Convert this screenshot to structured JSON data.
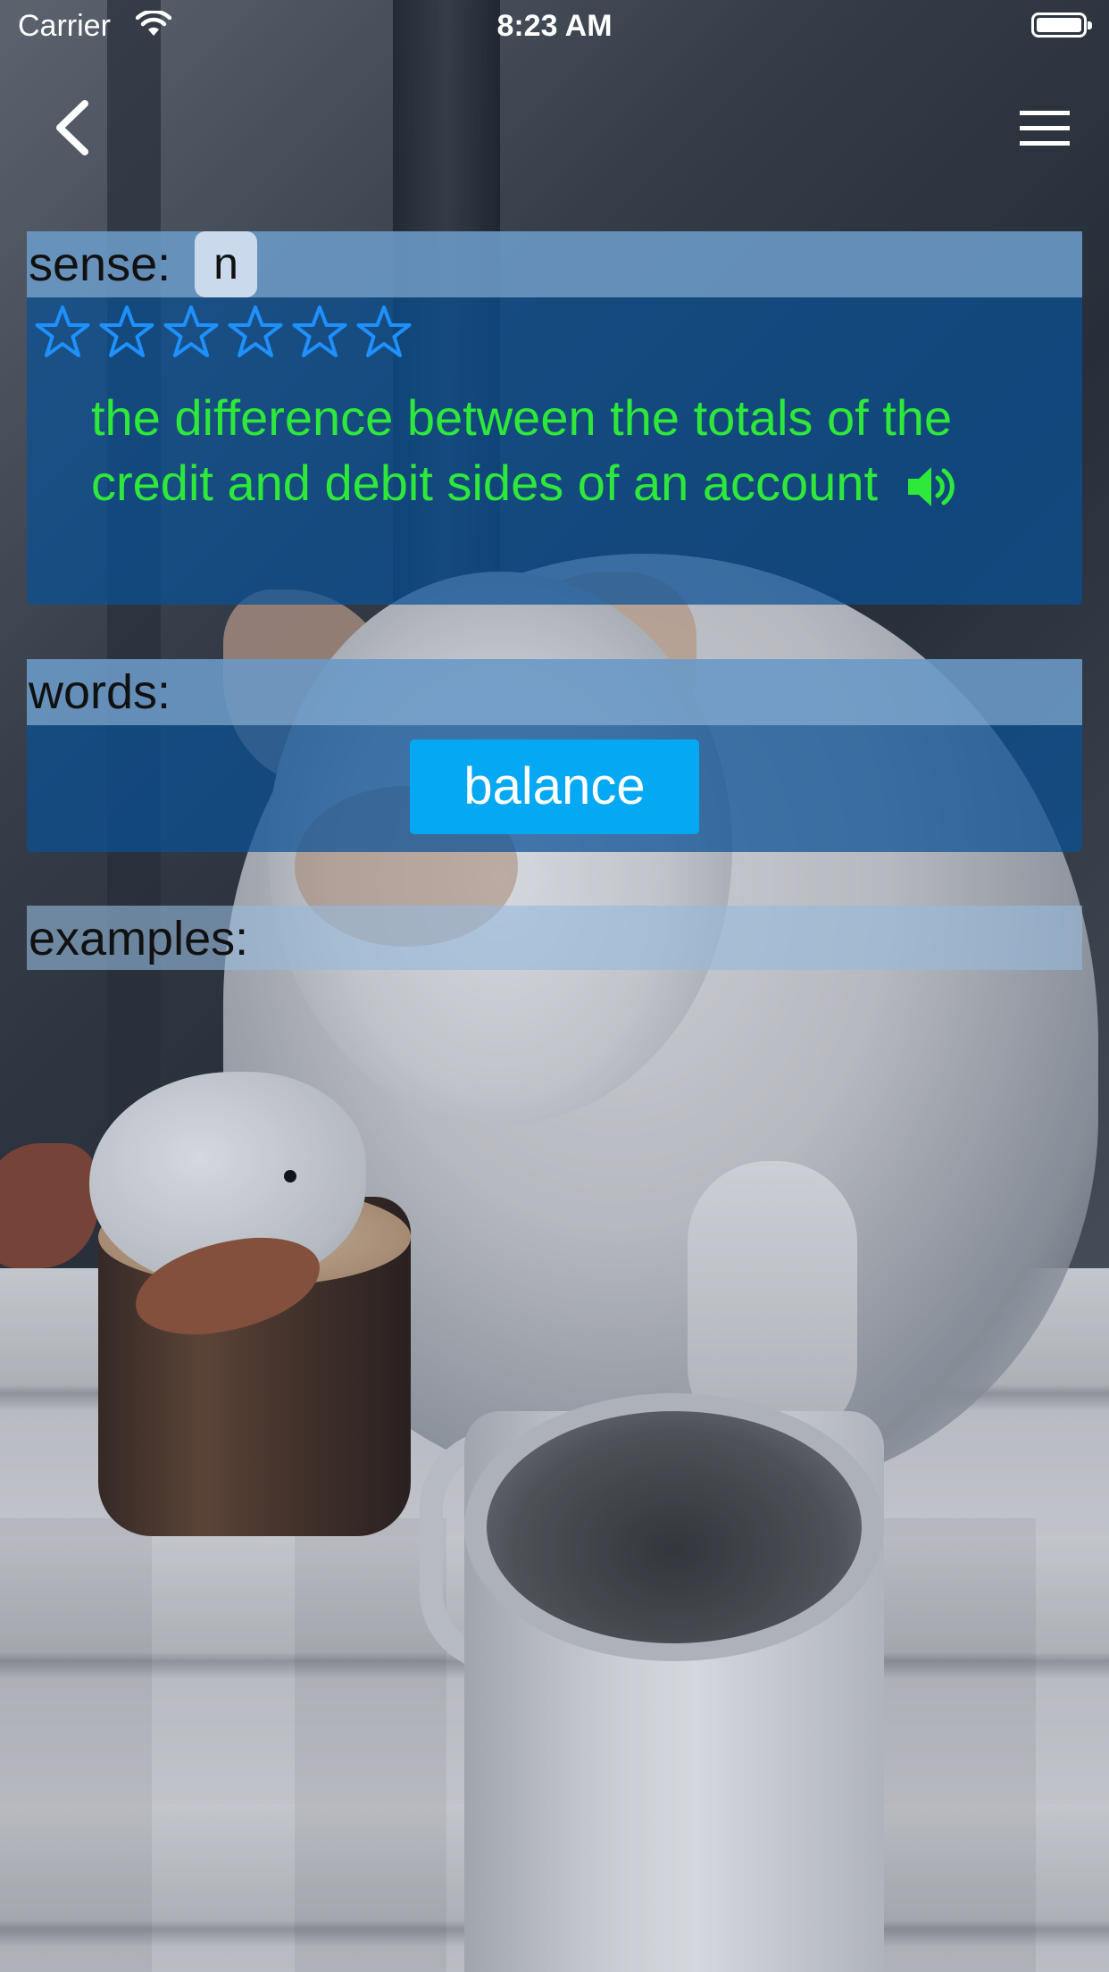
{
  "status_bar": {
    "carrier": "Carrier",
    "time": "8:23 AM"
  },
  "nav": {
    "back_icon": "chevron-left-icon",
    "menu_icon": "hamburger-menu-icon"
  },
  "sense": {
    "label": "sense:",
    "part_of_speech": "n",
    "rating": {
      "value": 0,
      "max": 6
    },
    "definition": "the difference between the totals of the credit and debit sides of an account",
    "speaker_icon": "speaker-icon"
  },
  "words": {
    "label": "words:",
    "items": [
      "balance"
    ]
  },
  "examples": {
    "label": "examples:"
  },
  "colors": {
    "definition_text": "#2ee83a",
    "word_button": "#05a8f2",
    "star_outline": "#1e90ff",
    "card_bg": "#0a5096"
  }
}
